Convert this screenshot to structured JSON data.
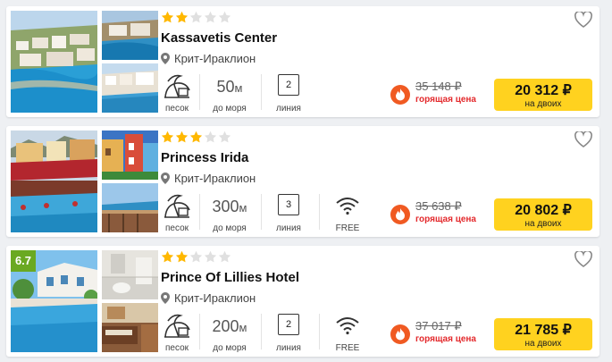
{
  "hotels": [
    {
      "stars": 2,
      "max_stars": 5,
      "rating": "",
      "name": "Kassavetis Center",
      "location": "Крит-Ираклион",
      "beach_type": "песок",
      "distance_value": "50",
      "distance_unit": "м",
      "distance_label": "до моря",
      "line_number": "2",
      "line_label": "линия",
      "wifi_label": "",
      "old_price": "35 148 ₽",
      "hot_label": "горящая цена",
      "price": "20 312 ₽",
      "price_sub": "на двоих"
    },
    {
      "stars": 3,
      "max_stars": 5,
      "rating": "",
      "name": "Princess Irida",
      "location": "Крит-Ираклион",
      "beach_type": "песок",
      "distance_value": "300",
      "distance_unit": "м",
      "distance_label": "до моря",
      "line_number": "3",
      "line_label": "линия",
      "wifi_label": "FREE",
      "old_price": "35 638 ₽",
      "hot_label": "горящая цена",
      "price": "20 802 ₽",
      "price_sub": "на двоих"
    },
    {
      "stars": 2,
      "max_stars": 5,
      "rating": "6.7",
      "name": "Prince Of Lillies Hotel",
      "location": "Крит-Ираклион",
      "beach_type": "песок",
      "distance_value": "200",
      "distance_unit": "м",
      "distance_label": "до моря",
      "line_number": "2",
      "line_label": "линия",
      "wifi_label": "FREE",
      "old_price": "37 017 ₽",
      "hot_label": "горящая цена",
      "price": "21 785 ₽",
      "price_sub": "на двоих"
    }
  ],
  "icons": {
    "star": "star-icon",
    "pin": "location-pin-icon",
    "beach": "beach-umbrella-icon",
    "wifi": "wifi-icon",
    "fire": "fire-icon",
    "heart": "heart-icon"
  },
  "colors": {
    "star_filled": "#ffb800",
    "star_empty": "#e0e0e0",
    "price_button": "#ffd21f",
    "hot_red": "#e3282b",
    "fire_orange": "#f05a22",
    "rating_green": "#6aa922"
  }
}
